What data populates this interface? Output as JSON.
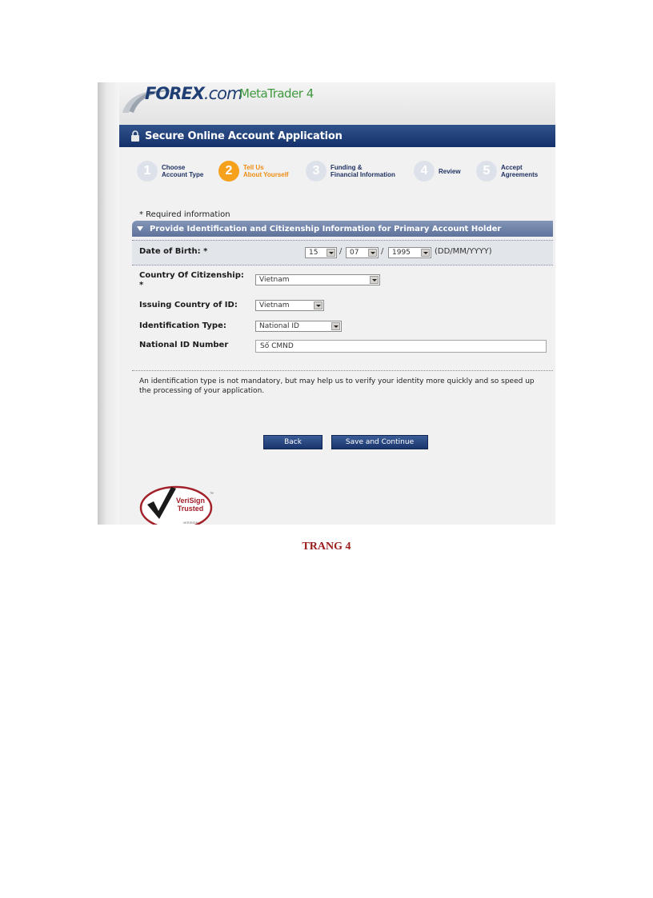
{
  "header": {
    "logo_forex": "FOREX",
    "logo_com": ".com",
    "logo_metatrader": "MetaTrader 4"
  },
  "titlebar": {
    "title": "Secure Online Account Application"
  },
  "steps": [
    {
      "number": "1",
      "label": "Choose\nAccount Type",
      "active": false
    },
    {
      "number": "2",
      "label": "Tell Us\nAbout Yourself",
      "active": true
    },
    {
      "number": "3",
      "label": "Funding &\nFinancial Information",
      "active": false
    },
    {
      "number": "4",
      "label": "Review",
      "active": false
    },
    {
      "number": "5",
      "label": "Accept\nAgreements",
      "active": false
    }
  ],
  "form": {
    "required_note": "* Required information",
    "section_title": "Provide Identification and Citizenship Information for Primary Account Holder",
    "dob": {
      "label": "Date of Birth: *",
      "day": "15",
      "month": "07",
      "year": "1995",
      "separator": "/",
      "format_hint": "(DD/MM/YYYY)"
    },
    "citizenship": {
      "label_line1": "Country Of Citizenship:",
      "label_line2": "*",
      "value": "Vietnam"
    },
    "issuing_country": {
      "label": "Issuing Country of ID:",
      "value": "Vietnam"
    },
    "id_type": {
      "label": "Identification Type:",
      "value": "National ID"
    },
    "id_number": {
      "label": "National ID Number",
      "value": "Số CMND"
    },
    "note": "An identification type is not mandatory, but may help us to verify your identity more quickly and so speed up the processing of your application."
  },
  "buttons": {
    "back": "Back",
    "save_continue": "Save and Continue"
  },
  "seal": {
    "line1": "VeriSign",
    "line2": "Trusted",
    "tm": "™",
    "sub": "VERISIGN"
  },
  "caption": "TRANG 4",
  "colors": {
    "navy": "#1b356c",
    "active_step": "#f5a11b",
    "caption": "#9b1b1b"
  }
}
